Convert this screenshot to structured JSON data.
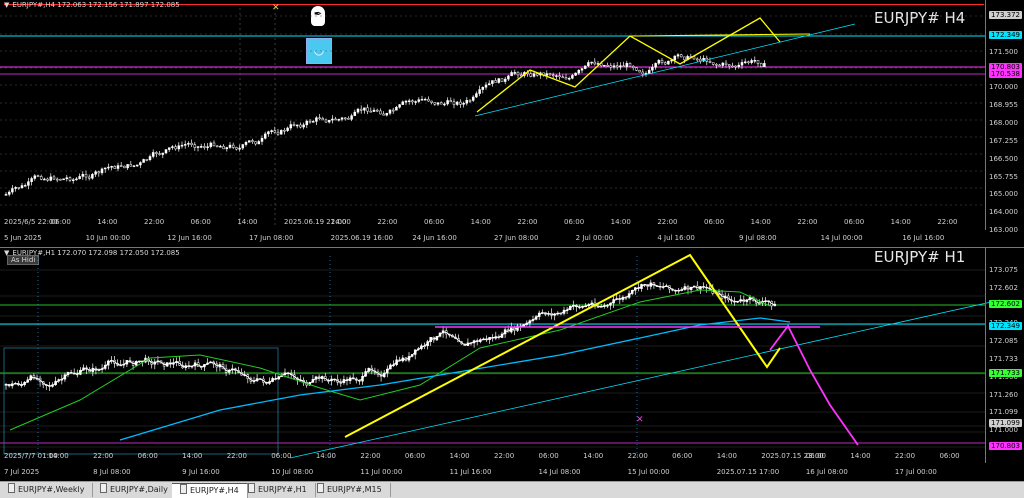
{
  "colors": {
    "background": "#000000",
    "candle": "#ffffff",
    "up_trend": "#ffff00",
    "trendline": "#00e5ff",
    "level_magenta": "#ff33ff",
    "level_green": "#33ff33",
    "ma_white": "#ffffff",
    "ma_green": "#22cc22",
    "ma_cyan": "#00bbff",
    "bid_line": "#ff3030"
  },
  "top_chart": {
    "title": "EURJPY#,H4  172.063 172.156 171.897 172.085",
    "symbol_label": "EURJPY# H4",
    "price_ticks": [
      "173.372",
      "172.349",
      "171.500",
      "170.803",
      "170.000",
      "168.955",
      "168.000",
      "167.255",
      "166.500",
      "165.755",
      "165.000",
      "164.000",
      "163.000"
    ],
    "price_tags": [
      {
        "label": "173.372",
        "bg": "#cfcfcf",
        "fg": "#000000"
      },
      {
        "label": "172.349",
        "bg": "#00e5ff",
        "fg": "#000000"
      },
      {
        "label": "170.803",
        "bg": "#ff33ff",
        "fg": "#000000"
      },
      {
        "label": "170.538",
        "bg": "#ff33ff",
        "fg": "#000000"
      }
    ],
    "time_row1": [
      "2025/6/5 22:00",
      "06:00",
      "14:00",
      "22:00",
      "06:00",
      "14:00",
      "2025.06.19 22:00",
      "14:00",
      "22:00",
      "06:00",
      "14:00",
      "22:00",
      "06:00",
      "14:00",
      "22:00",
      "06:00",
      "14:00",
      "22:00",
      "06:00",
      "14:00",
      "22:00"
    ],
    "time_row2": [
      "5 Jun 2025",
      "10 Jun 00:00",
      "12 Jun 16:00",
      "17 Jun 08:00",
      "2025.06.19 16:00",
      "24 Jun 16:00",
      "27 Jun 08:00",
      "2 Jul 00:00",
      "4 Jul 16:00",
      "9 Jul 08:00",
      "14 Jul 00:00",
      "16 Jul 16:00"
    ]
  },
  "bottom_chart": {
    "title": "EURJPY#,H1  172.070 172.098 172.050 172.085",
    "hide_button": "As Hidi",
    "symbol_label": "EURJPY# H1",
    "price_ticks": [
      "173.075",
      "172.602",
      "172.500",
      "172.349",
      "172.085",
      "171.733",
      "171.500",
      "171.260",
      "171.099",
      "171.000",
      "170.803"
    ],
    "price_tags": [
      {
        "label": "172.602",
        "bg": "#33ff33",
        "fg": "#000000"
      },
      {
        "label": "172.349",
        "bg": "#00e5ff",
        "fg": "#000000"
      },
      {
        "label": "171.733",
        "bg": "#33ff33",
        "fg": "#000000"
      },
      {
        "label": "171.099",
        "bg": "#cfcfcf",
        "fg": "#000000"
      },
      {
        "label": "170.803",
        "bg": "#ff33ff",
        "fg": "#000000"
      }
    ],
    "time_row1": [
      "2025/7/7 01:00",
      "14:00",
      "22:00",
      "06:00",
      "14:00",
      "22:00",
      "06:00",
      "14:00",
      "22:00",
      "06:00",
      "14:00",
      "22:00",
      "06:00",
      "14:00",
      "22:00",
      "06:00",
      "14:00",
      "2025.07.15 23:00",
      "06:00",
      "14:00",
      "22:00",
      "06:00"
    ],
    "time_row2": [
      "7 Jul 2025",
      "8 Jul 08:00",
      "9 Jul 16:00",
      "10 Jul 08:00",
      "11 Jul 00:00",
      "11 Jul 16:00",
      "14 Jul 08:00",
      "15 Jul 00:00",
      "2025.07.15 17:00",
      "16 Jul 08:00",
      "17 Jul 00:00"
    ]
  },
  "tabs": [
    "EURJPY#,Weekly",
    "EURJPY#,Daily",
    "EURJPY#,H4",
    "EURJPY#,H1",
    "EURJPY#,M15"
  ],
  "active_tab": "EURJPY#,H4"
}
